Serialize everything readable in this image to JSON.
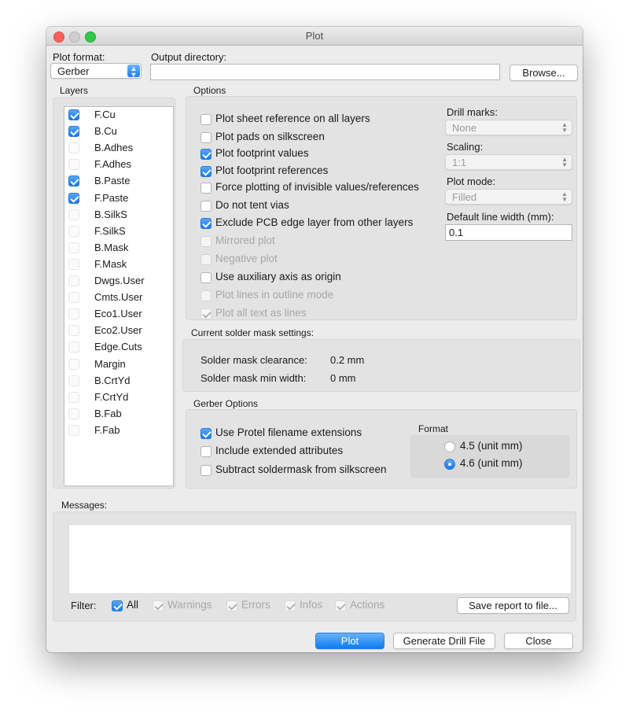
{
  "window": {
    "title": "Plot"
  },
  "top": {
    "plot_format_label": "Plot format:",
    "plot_format_value": "Gerber",
    "output_dir_label": "Output directory:",
    "output_dir_value": "",
    "browse_label": "Browse..."
  },
  "layers": {
    "title": "Layers",
    "items": [
      {
        "label": "F.Cu",
        "checked": true
      },
      {
        "label": "B.Cu",
        "checked": true
      },
      {
        "label": "B.Adhes",
        "checked": false
      },
      {
        "label": "F.Adhes",
        "checked": false
      },
      {
        "label": "B.Paste",
        "checked": true
      },
      {
        "label": "F.Paste",
        "checked": true
      },
      {
        "label": "B.SilkS",
        "checked": false
      },
      {
        "label": "F.SilkS",
        "checked": false
      },
      {
        "label": "B.Mask",
        "checked": false
      },
      {
        "label": "F.Mask",
        "checked": false
      },
      {
        "label": "Dwgs.User",
        "checked": false
      },
      {
        "label": "Cmts.User",
        "checked": false
      },
      {
        "label": "Eco1.User",
        "checked": false
      },
      {
        "label": "Eco2.User",
        "checked": false
      },
      {
        "label": "Edge.Cuts",
        "checked": false
      },
      {
        "label": "Margin",
        "checked": false
      },
      {
        "label": "B.CrtYd",
        "checked": false
      },
      {
        "label": "F.CrtYd",
        "checked": false
      },
      {
        "label": "B.Fab",
        "checked": false
      },
      {
        "label": "F.Fab",
        "checked": false
      }
    ]
  },
  "options": {
    "title": "Options",
    "checks": [
      {
        "label": "Plot sheet reference on all layers",
        "checked": false,
        "enabled": true
      },
      {
        "label": "Plot pads on silkscreen",
        "checked": false,
        "enabled": true
      },
      {
        "label": "Plot footprint values",
        "checked": true,
        "enabled": true
      },
      {
        "label": "Plot footprint references",
        "checked": true,
        "enabled": true
      },
      {
        "label": "Force plotting of invisible values/references",
        "checked": false,
        "enabled": true
      },
      {
        "label": "Do not tent vias",
        "checked": false,
        "enabled": true
      },
      {
        "label": "Exclude PCB edge layer from other layers",
        "checked": true,
        "enabled": true
      },
      {
        "label": "Mirrored plot",
        "checked": false,
        "enabled": false
      },
      {
        "label": "Negative plot",
        "checked": false,
        "enabled": false
      },
      {
        "label": "Use auxiliary axis as origin",
        "checked": false,
        "enabled": true
      },
      {
        "label": "Plot lines in outline mode",
        "checked": false,
        "enabled": false
      },
      {
        "label": "Plot all text as lines",
        "checked": true,
        "enabled": false
      }
    ],
    "drill_marks_label": "Drill marks:",
    "drill_marks_value": "None",
    "scaling_label": "Scaling:",
    "scaling_value": "1:1",
    "plot_mode_label": "Plot mode:",
    "plot_mode_value": "Filled",
    "line_width_label": "Default line width (mm):",
    "line_width_value": "0.1"
  },
  "solder_mask": {
    "title": "Current solder mask settings:",
    "clearance_label": "Solder mask clearance:",
    "clearance_value": "0.2 mm",
    "min_width_label": "Solder mask min width:",
    "min_width_value": "0 mm"
  },
  "gerber": {
    "title": "Gerber Options",
    "checks": [
      {
        "label": "Use Protel filename extensions",
        "checked": true
      },
      {
        "label": "Include extended attributes",
        "checked": false
      },
      {
        "label": "Subtract soldermask from silkscreen",
        "checked": false
      }
    ],
    "format_title": "Format",
    "format_options": [
      {
        "label": "4.5 (unit mm)",
        "selected": false
      },
      {
        "label": "4.6 (unit mm)",
        "selected": true
      }
    ]
  },
  "messages": {
    "title": "Messages:",
    "filter_label": "Filter:",
    "filters": [
      {
        "label": "All",
        "checked": true,
        "enabled": true
      },
      {
        "label": "Warnings",
        "checked": true,
        "enabled": false
      },
      {
        "label": "Errors",
        "checked": true,
        "enabled": false
      },
      {
        "label": "Infos",
        "checked": true,
        "enabled": false
      },
      {
        "label": "Actions",
        "checked": true,
        "enabled": false
      }
    ],
    "save_report_label": "Save report to file..."
  },
  "footer": {
    "plot_label": "Plot",
    "drill_label": "Generate Drill File",
    "close_label": "Close"
  },
  "colors": {
    "accent": "#1579ee",
    "window_bg": "#ececec",
    "group_bg": "#e3e3e3"
  }
}
